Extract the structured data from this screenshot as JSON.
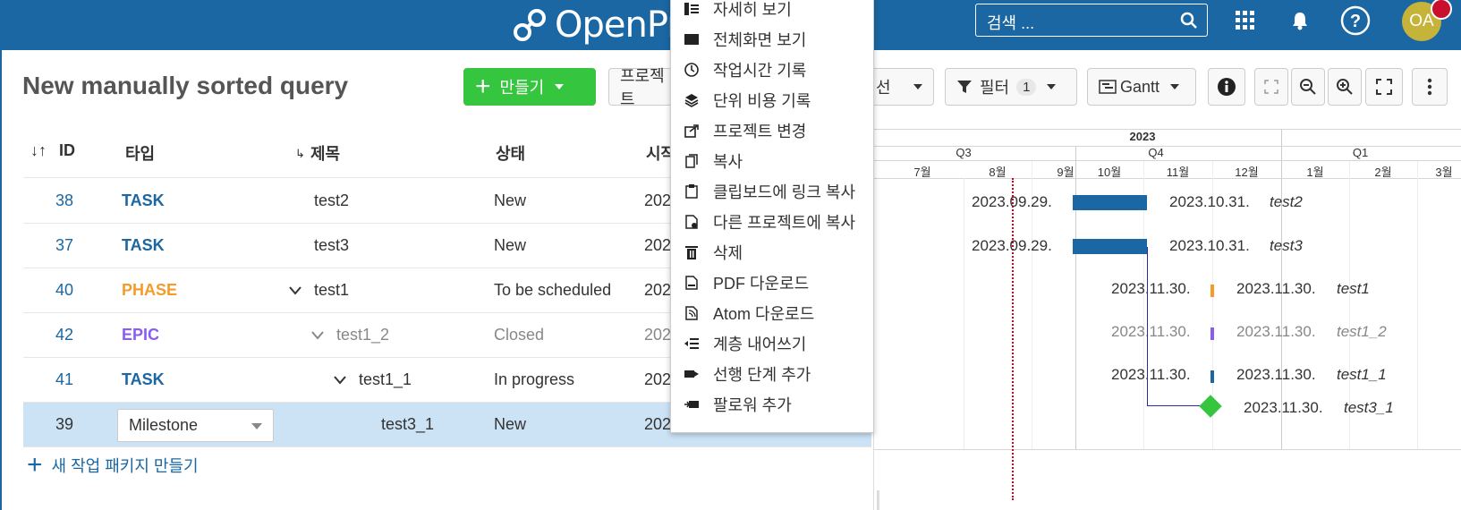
{
  "header": {
    "logo_text": "OpenProje",
    "search_placeholder": "검색 ...",
    "avatar_initials": "OA"
  },
  "toolbar": {
    "title": "New manually sorted query",
    "create_label": "만들기",
    "project_label": "프로젝트",
    "select_fragment": "선",
    "filter_label": "필터",
    "filter_count": "1",
    "view_label": "Gantt"
  },
  "table": {
    "headers": {
      "id": "ID",
      "type": "타입",
      "subject": "제목",
      "status": "상태",
      "start": "시작"
    },
    "rows": [
      {
        "id": "38",
        "type": "TASK",
        "subject": "test2",
        "status": "New",
        "start": "202"
      },
      {
        "id": "37",
        "type": "TASK",
        "subject": "test3",
        "status": "New",
        "start": "202"
      },
      {
        "id": "40",
        "type": "PHASE",
        "subject": "test1",
        "status": "To be scheduled",
        "start": "202"
      },
      {
        "id": "42",
        "type": "EPIC",
        "subject": "test1_2",
        "status": "Closed",
        "start": "202"
      },
      {
        "id": "41",
        "type": "TASK",
        "subject": "test1_1",
        "status": "In progress",
        "start": "202"
      },
      {
        "id": "39",
        "type": "Milestone",
        "subject": "test3_1",
        "status": "New",
        "start": "202"
      }
    ],
    "new_wp_label": "새 작업 패키지 만들기"
  },
  "gantt": {
    "year": "2023",
    "quarters": [
      "Q3",
      "Q4",
      "Q1"
    ],
    "months": [
      "7월",
      "8월",
      "9월",
      "10월",
      "11월",
      "12월",
      "1월",
      "2월",
      "3월"
    ],
    "rows": [
      {
        "start": "2023.09.29.",
        "end": "2023.10.31.",
        "label": "test2"
      },
      {
        "start": "2023.09.29.",
        "end": "2023.10.31.",
        "label": "test3"
      },
      {
        "start": "2023.11.30.",
        "end": "2023.11.30.",
        "label": "test1"
      },
      {
        "start": "2023.11.30.",
        "end": "2023.11.30.",
        "label": "test1_2"
      },
      {
        "start": "2023.11.30.",
        "end": "2023.11.30.",
        "label": "test1_1"
      },
      {
        "end": "2023.11.30.",
        "label": "test3_1"
      }
    ]
  },
  "context_menu": {
    "items": [
      "자세히 보기",
      "전체화면 보기",
      "작업시간 기록",
      "단위 비용 기록",
      "프로젝트 변경",
      "복사",
      "클립보드에 링크 복사",
      "다른 프로젝트에 복사",
      "삭제",
      "PDF 다운로드",
      "Atom 다운로드",
      "계층 내어쓰기",
      "선행 단계 추가",
      "팔로워 추가"
    ]
  },
  "colors": {
    "header": "#1a67a3",
    "create": "#35c53f",
    "phase": "#f59b2a",
    "epic": "#8a5cf0",
    "selected_row": "#cce3f6",
    "milestone": "#35c53f",
    "today_line": "#d0021b"
  }
}
